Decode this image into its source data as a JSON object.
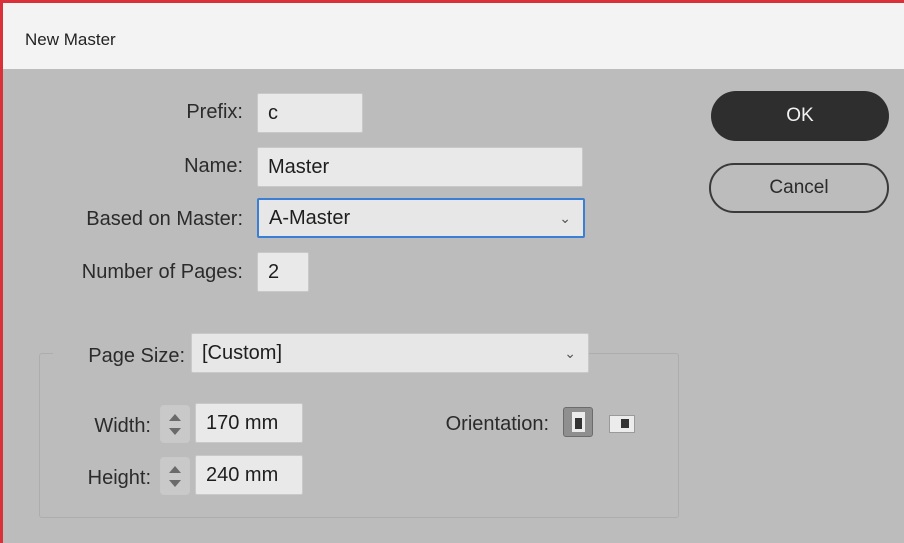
{
  "dialog": {
    "title": "New Master"
  },
  "fields": {
    "prefix": {
      "label": "Prefix:",
      "value": "c"
    },
    "name": {
      "label": "Name:",
      "value": "Master"
    },
    "based_on": {
      "label": "Based on Master:",
      "value": "A-Master"
    },
    "pages": {
      "label": "Number of Pages:",
      "value": "2"
    }
  },
  "page_size": {
    "label": "Page Size:",
    "value": "[Custom]",
    "width_label": "Width:",
    "width_value": "170 mm",
    "height_label": "Height:",
    "height_value": "240 mm",
    "orientation_label": "Orientation:",
    "orientation_selected": "portrait"
  },
  "buttons": {
    "ok": "OK",
    "cancel": "Cancel"
  },
  "icons": {
    "dropdown": "chevron-down-icon",
    "stepper": "stepper-icon",
    "portrait": "portrait-orientation-icon",
    "landscape": "landscape-orientation-icon"
  },
  "colors": {
    "accent_border": "#d9303a",
    "focus_border": "#3a7fd5",
    "ok_button": "#2e2e2e"
  }
}
